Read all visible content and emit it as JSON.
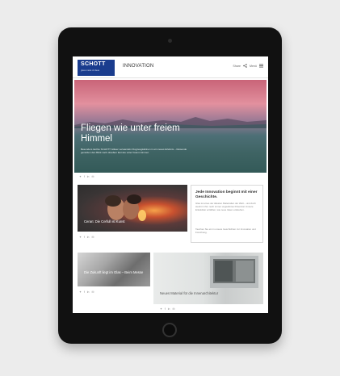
{
  "colors": {
    "brand": "#1a3c8e",
    "background": "#ececec",
    "device": "#111111"
  },
  "header": {
    "logo_text": "SCHOTT",
    "logo_tagline": "glass made of ideas",
    "section_title": "INNOVATION",
    "share_label": "Share",
    "menu_label": "Menü",
    "share_icon": "share-icon",
    "menu_icon": "hamburger-icon"
  },
  "hero": {
    "title": "Fliegen wie unter freiem Himmel",
    "text": "Besonders leichte SCHOTT Gläser verwandeln Flugzeugkabinen in ein neues Erlebnis – Reisende genießen den Blick nach draußen fast wie unter freiem Himmel."
  },
  "social_icons": [
    "twitter-icon",
    "facebook-icon",
    "linkedin-icon",
    "email-icon"
  ],
  "social_glyphs": [
    "✦",
    "f",
    "in",
    "✉"
  ],
  "cards": {
    "kiss": {
      "caption": "Ceran: Die Cerfull ist Kunst"
    },
    "quote": {
      "title": "Jede Innovation beginnt mit einer Geschichte.",
      "text": "Glas ist eines der ältesten Materialien der Welt – und doch steckt in ihm noch immer ungeahntes Potenzial. Unsere Entwickler erzählen, wie neue Ideen entstehen.",
      "footer": "Tauchen Sie ein in unsere Geschichten zur Innovation und Forschung."
    },
    "glass": {
      "caption": "Die Zukunft liegt im Glas – Beim Messe"
    },
    "kitchen": {
      "caption": "Neues Material für die Innenarchitektur"
    }
  }
}
